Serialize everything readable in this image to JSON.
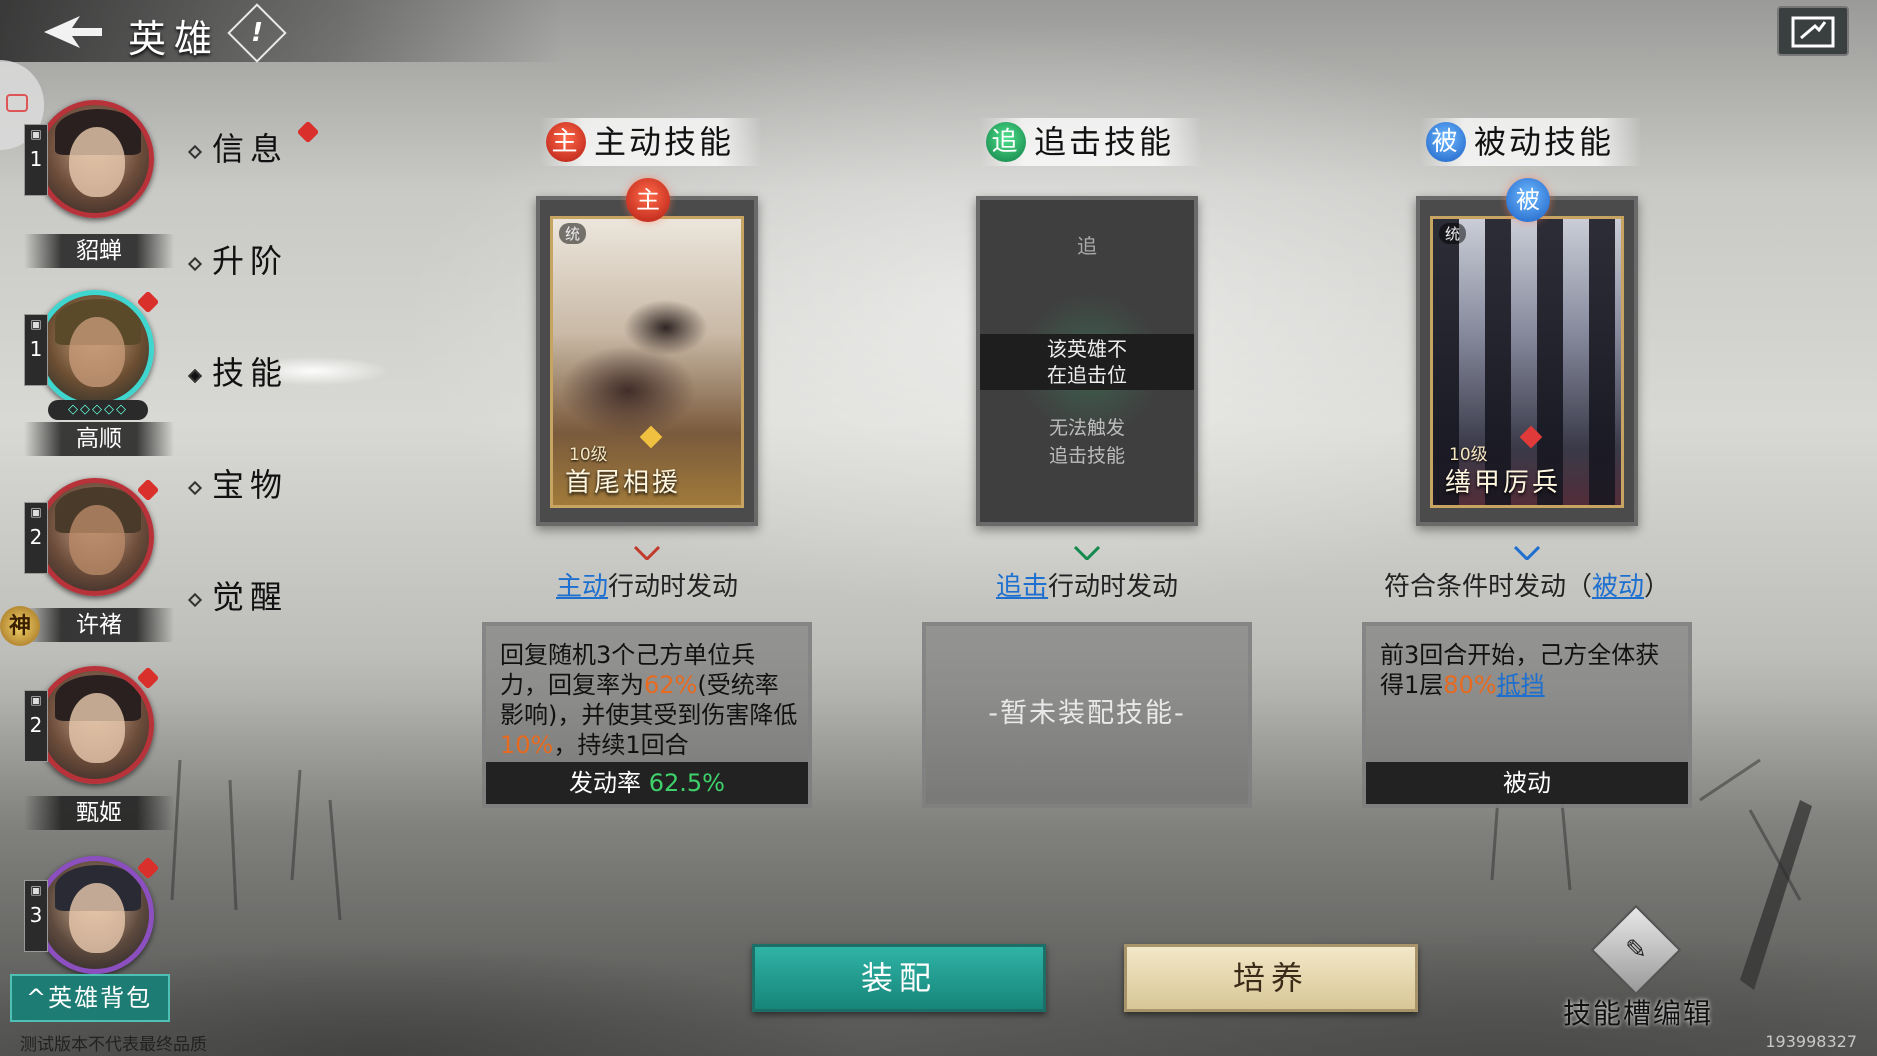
{
  "header": {
    "title": "英雄",
    "help": "!"
  },
  "heroes": [
    {
      "name": "貂蝉",
      "level": "1",
      "ring": "red"
    },
    {
      "name": "高顺",
      "level": "1",
      "ring": "cyan",
      "stars": "◇◇◇◇◇"
    },
    {
      "name": "许褚",
      "level": "2",
      "ring": "red",
      "badge": "神"
    },
    {
      "name": "甄姬",
      "level": "2",
      "ring": "red"
    },
    {
      "name": "",
      "level": "3",
      "ring": "purple"
    }
  ],
  "menu": [
    {
      "label": "信息",
      "dot": true
    },
    {
      "label": "升阶"
    },
    {
      "label": "技能",
      "active": true
    },
    {
      "label": "宝物"
    },
    {
      "label": "觉醒"
    }
  ],
  "skills": {
    "active": {
      "header": "主动技能",
      "badge": "主",
      "card_tag": "统",
      "card_level": "10级",
      "card_name": "首尾相援",
      "trigger_kw": "主动",
      "trigger_rest": "行动时发动",
      "desc_1": "回复随机3个己方单位兵力，回复率为",
      "desc_pct1": "62%",
      "desc_2": "(受统率影响)，并使其受到伤害降低",
      "desc_pct2": "10%",
      "desc_3": "，持续1回合",
      "footer_label": "发动率",
      "footer_value": "62.5%"
    },
    "chase": {
      "header": "追击技能",
      "badge": "追",
      "card_top": "追",
      "card_band_1": "该英雄不",
      "card_band_2": "在追击位",
      "card_cannot_1": "无法触发",
      "card_cannot_2": "追击技能",
      "trigger_kw": "追击",
      "trigger_rest": "行动时发动",
      "empty_text": "-暂未装配技能-"
    },
    "passive": {
      "header": "被动技能",
      "badge": "被",
      "card_tag": "统",
      "card_level": "10级",
      "card_name": "缮甲厉兵",
      "trigger_pre": "符合条件时发动（",
      "trigger_kw": "被动",
      "trigger_post": "）",
      "desc_1": "前3回合开始，己方全体获得1层",
      "desc_pct": "80%",
      "desc_link": "抵挡",
      "footer": "被动"
    }
  },
  "buttons": {
    "equip": "装配",
    "train": "培养",
    "slot_edit": "技能槽编辑",
    "slot_edit_icon": "pen-icon",
    "hero_bag": "英雄背包"
  },
  "footer": {
    "notice": "测试版本不代表最终品质",
    "uid": "193998327"
  },
  "colors": {
    "accent_teal": "#1d7d74",
    "active_red": "#b31c12",
    "chase_green": "#0f7d44",
    "passive_blue": "#1a5fc4",
    "highlight_orange": "#e86a1f",
    "rate_green": "#3fd16a"
  }
}
